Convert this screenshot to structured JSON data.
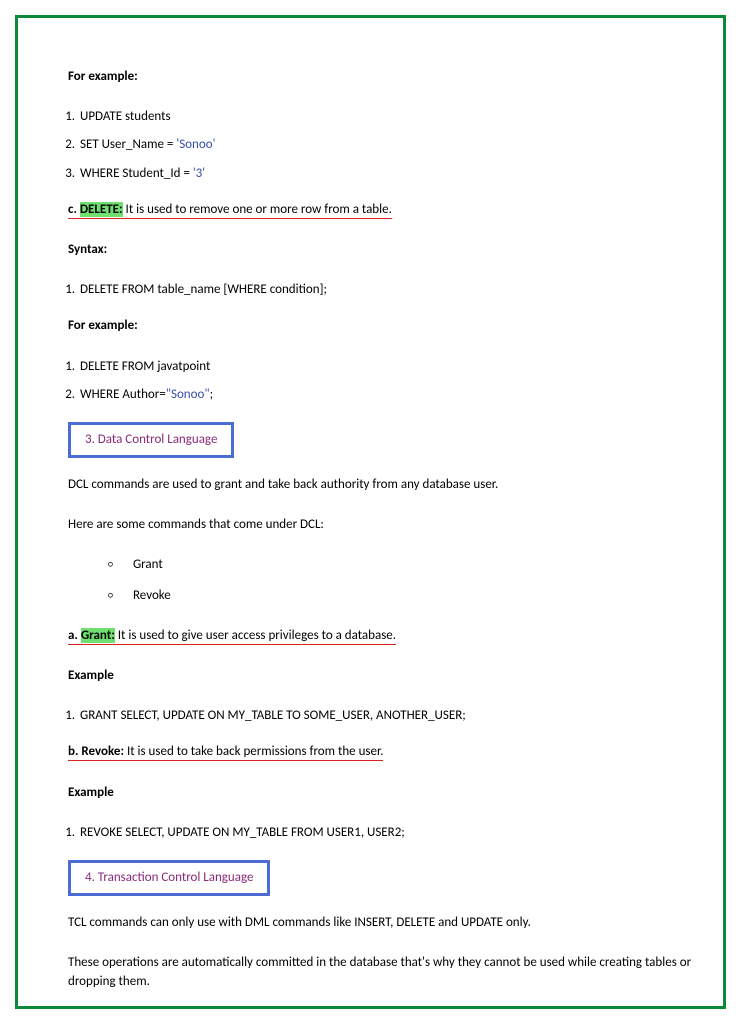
{
  "intro": {
    "for_example": "For example:"
  },
  "update_example": {
    "l1": "UPDATE students",
    "l2_pre": "SET User_Name = ",
    "l2_str": "'Sonoo'",
    "l3_pre": "WHERE Student_Id = ",
    "l3_str": "'3'"
  },
  "delete_section": {
    "prefix": "c. ",
    "keyword": "DELETE:",
    "desc": " It is used to remove one or more row from a table.",
    "syntax_label": "Syntax:",
    "syntax_line": "DELETE FROM table_name [WHERE condition];",
    "for_example": "For example:",
    "ex_l1": "DELETE FROM javatpoint",
    "ex_l2_pre": "WHERE Author=",
    "ex_l2_str": "\"Sonoo\"",
    "ex_l2_post": ";"
  },
  "dcl": {
    "title": "3. Data Control Language",
    "desc1": "DCL commands are used to grant and take back authority from any database user.",
    "desc2": "Here are some commands that come under DCL:",
    "bullets": {
      "b1": "Grant",
      "b2": "Revoke"
    },
    "grant_prefix": "a. ",
    "grant_keyword": "Grant:",
    "grant_desc": " It is used to give user access privileges to a database.",
    "example_label": "Example",
    "grant_code": "GRANT SELECT, UPDATE ON MY_TABLE TO SOME_USER, ANOTHER_USER;",
    "revoke_prefix": "b. ",
    "revoke_keyword": "Revoke:",
    "revoke_desc": " It is used to take back permissions from the user.",
    "revoke_code": "REVOKE SELECT, UPDATE ON MY_TABLE FROM USER1, USER2;"
  },
  "tcl": {
    "title": "4. Transaction Control Language",
    "desc1": "TCL commands can only use with DML commands like INSERT, DELETE and UPDATE only.",
    "desc2": "These operations are automatically committed in the database that's why they cannot be used while creating tables or dropping them."
  }
}
